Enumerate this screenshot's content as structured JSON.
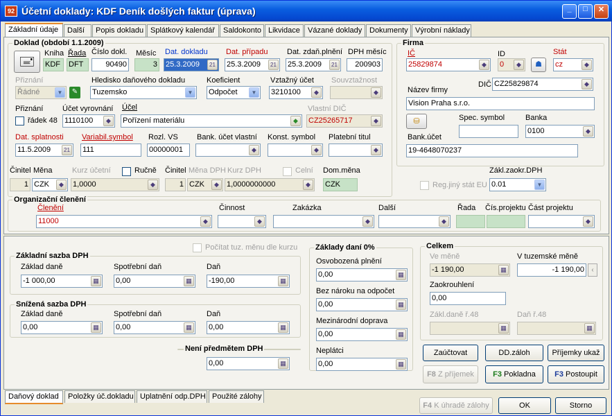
{
  "window": {
    "title": "Účetní doklady: KDF Deník došlých faktur (úprava)",
    "icon": "app-icon"
  },
  "tabs": [
    "Základní údaje",
    "Další",
    "Popis dokladu",
    "Splátkový kalendář",
    "Saldokonto",
    "Likvidace",
    "Vázané doklady",
    "Dokumenty",
    "Výrobní náklady"
  ],
  "doklad": {
    "legend": "Doklad (období 1.1.2009)",
    "kniha_label": "Kniha",
    "kniha": "KDF",
    "rada_label": "Řada",
    "rada": "DFT",
    "cislo_label": "Číslo dokl.",
    "cislo": "90490",
    "mesic_label": "Měsíc",
    "mesic": "3",
    "dat_dokladu_label": "Dat. dokladu",
    "dat_dokladu": "25.3.2009",
    "dat_pripadu_label": "Dat. případu",
    "dat_pripadu": "25.3.2009",
    "dat_zdan_label": "Dat. zdaň.plnění",
    "dat_zdan": "25.3.2009",
    "dph_mesic_label": "DPH měsíc",
    "dph_mesic": "200903",
    "priznani_label": "Přiznání",
    "priznani": "Řádné",
    "hledisko_label": "Hledisko daňového dokladu",
    "hledisko": "Tuzemsko",
    "koeficient_label": "Koeficient",
    "koeficient": "Odpočet",
    "vztazny_label": "Vztažný účet",
    "vztazny": "3210100",
    "souvztaznost_label": "Souvztažnost",
    "priznani2_label": "Přiznání",
    "radek48": "řádek 48",
    "ucet_vyr_label": "Účet vyrovnání",
    "ucet_vyr": "1110100",
    "ucel_label": "Účel",
    "ucel": "Pořízení materiálu",
    "vlastni_dic_label": "Vlastní DIČ",
    "vlastni_dic": "CZ25265717",
    "dat_splat_label": "Dat. splatnosti",
    "dat_splat": "11.5.2009",
    "variabil_label": "Variabil.symbol",
    "variabil": "111",
    "rozl_vs_label": "Rozl. VS",
    "rozl_vs": "00000001",
    "bank_ucet_label": "Bank. účet vlastní",
    "konst_label": "Konst. symbol",
    "plat_titul_label": "Platební titul"
  },
  "firma": {
    "legend": "Firma",
    "ic_label": "IČ",
    "ic": "25829874",
    "id_label": "ID",
    "id": "0",
    "stat_label": "Stát",
    "stat": "cz",
    "dic_label": "DIČ",
    "dic": "CZ25829874",
    "nazev_label": "Název firmy",
    "nazev": "Vision Praha s.r.o.",
    "spec_label": "Spec. symbol",
    "banka_label": "Banka",
    "banka": "0100",
    "bank_ucet_label": "Bank.účet",
    "bank_ucet": "19-4648070237"
  },
  "mena": {
    "cinitel_label": "Činitel",
    "mena_label": "Měna",
    "cinitel": "1",
    "mena": "CZK",
    "kurz_label": "Kurz účetní",
    "kurz": "1,0000",
    "rucne": "Ručně",
    "cinitel2_label": "Činitel",
    "mena_dph_label": "Měna DPH",
    "cinitel2": "1",
    "mena_dph": "CZK",
    "kurz_dph_label": "Kurz DPH",
    "kurz_dph": "1,0000000000",
    "celni": "Celní",
    "dom_mena_label": "Dom.měna",
    "dom_mena": "CZK",
    "reg_eu": "Reg.jiný stát EU",
    "zakl_zaokr_label": "Zákl.zaokr.DPH",
    "zakl_zaokr": "0.01"
  },
  "org": {
    "legend": "Organizační členění",
    "cleneni_label": "Členění",
    "cleneni": "11000",
    "cinnost_label": "Činnost",
    "zakazka_label": "Zakázka",
    "dalsi_label": "Další",
    "rada_label": "Řada",
    "cis_proj_label": "Čís.projektu",
    "cast_proj_label": "Část projektu"
  },
  "zakladni": {
    "legend": "Základní sazba DPH",
    "pocitat": "Počítat tuz. měnu dle kurzu",
    "zaklad_label": "Základ daně",
    "zaklad": "-1 000,00",
    "spotr_label": "Spotřební daň",
    "spotr": "0,00",
    "dan_label": "Daň",
    "dan": "-190,00"
  },
  "snizena": {
    "legend": "Snížená sazba DPH",
    "zaklad_label": "Základ daně",
    "zaklad": "0,00",
    "spotr_label": "Spotřební daň",
    "spotr": "0,00",
    "dan_label": "Daň",
    "dan": "0,00"
  },
  "neni": {
    "legend": "Není předmětem DPH",
    "value": "0,00"
  },
  "zaklady0": {
    "legend": "Základy daní 0%",
    "osvob_label": "Osvobozená plnění",
    "osvob": "0,00",
    "bez_label": "Bez nároku na odpočet",
    "bez": "0,00",
    "mezi_label": "Mezinárodní doprava",
    "mezi": "0,00",
    "neplatci_label": "Neplátci",
    "neplatci": "0,00"
  },
  "celkem": {
    "legend": "Celkem",
    "ve_mene_label": "Ve měně",
    "ve_mene": "-1 190,00",
    "tuz_label": "V tuzemské měně",
    "tuz": "-1 190,00",
    "zaokr_label": "Zaokrouhlení",
    "zaokr": "0,00",
    "zakl48_label": "Zákl.daně ř.48",
    "dan48_label": "Daň ř.48"
  },
  "buttons": {
    "zauctovat": "Zaúčtovat",
    "dd_zaloh": "DD.záloh",
    "prijemky": "Příjemky ukaž",
    "z_prijemek_key": "F8",
    "z_prijemek": "Z příjemek",
    "pokladna_key": "F3",
    "pokladna": "Pokladna",
    "postoupit_key": "F3",
    "postoupit": "Postoupit",
    "k_uhrade_key": "F4",
    "k_uhrade": "K úhradě zálohy",
    "ok": "OK",
    "storno": "Storno"
  },
  "bottom_tabs": [
    "Daňový doklad",
    "Položky úč.dokladu",
    "Uplatnění odp.DPH",
    "Použité zálohy"
  ]
}
